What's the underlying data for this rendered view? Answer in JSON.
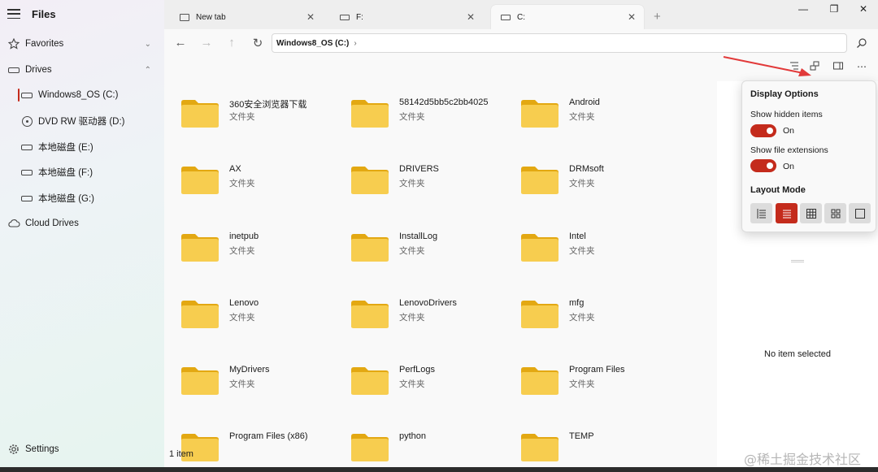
{
  "app": {
    "name": "Files"
  },
  "sidebar": {
    "favorites": "Favorites",
    "drives": "Drives",
    "drive_items": [
      "Windows8_OS (C:)",
      "DVD RW 驱动器 (D:)",
      "本地磁盘 (E:)",
      "本地磁盘 (F:)",
      "本地磁盘 (G:)"
    ],
    "cloud": "Cloud Drives",
    "settings": "Settings"
  },
  "tabs": [
    {
      "label": "New tab"
    },
    {
      "label": "F:"
    },
    {
      "label": "C:"
    }
  ],
  "address": {
    "segment": "Windows8_OS (C:)"
  },
  "folder_type": "文件夹",
  "folders": [
    "360安全浏览器下载",
    "58142d5bb5c2bb4025",
    "Android",
    "AX",
    "DRIVERS",
    "DRMsoft",
    "inetpub",
    "InstallLog",
    "Intel",
    "Lenovo",
    "LenovoDrivers",
    "mfg",
    "MyDrivers",
    "PerfLogs",
    "Program Files",
    "Program Files (x86)",
    "python",
    "TEMP"
  ],
  "status": {
    "text": "1 item"
  },
  "details": {
    "empty": "No item selected"
  },
  "display_options": {
    "title": "Display Options",
    "hidden_label": "Show hidden items",
    "hidden_state": "On",
    "ext_label": "Show file extensions",
    "ext_state": "On",
    "layout_label": "Layout Mode",
    "layout_modes": [
      "details-icon",
      "list-icon",
      "tiles-icon",
      "grid-icon",
      "columns-icon"
    ],
    "active_layout": "list-icon"
  },
  "watermark": "@稀土掘金技术社区",
  "colors": {
    "accent": "#c42b1c",
    "folder": "#f4c542",
    "arrow": "#e23a3a"
  }
}
